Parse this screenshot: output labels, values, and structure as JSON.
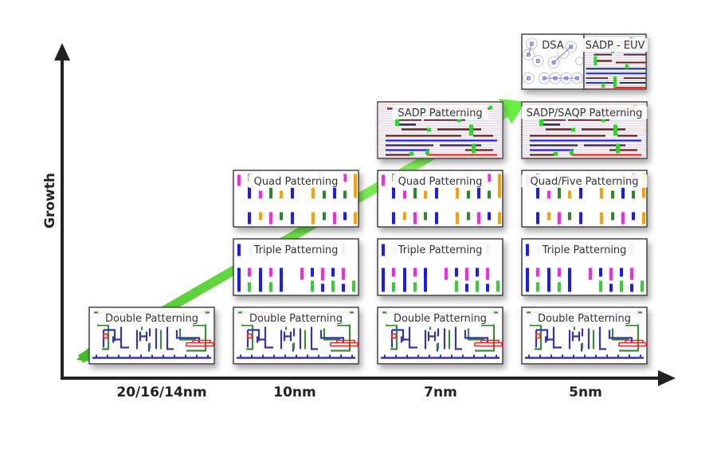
{
  "axes": {
    "y_label": "Growth",
    "x_categories": [
      "20/16/14nm",
      "10nm",
      "7nm",
      "5nm"
    ]
  },
  "boxes": {
    "double": "Double Patterning",
    "triple": "Triple Patterning",
    "quad": "Quad Patterning",
    "quad_five": "Quad/Five Patterning",
    "sadp": "SADP Patterning",
    "sadp_saqp": "SADP/SAQP Patterning",
    "dsa": "DSA",
    "sadp_euv": "SADP - EUV"
  },
  "colors": {
    "arrow": "#55e033",
    "axis": "#222222",
    "blue": "#1a1aff",
    "green": "#3a9a3a",
    "magenta": "#ff22ee",
    "orange": "#ffa000",
    "red": "#ff2020"
  }
}
